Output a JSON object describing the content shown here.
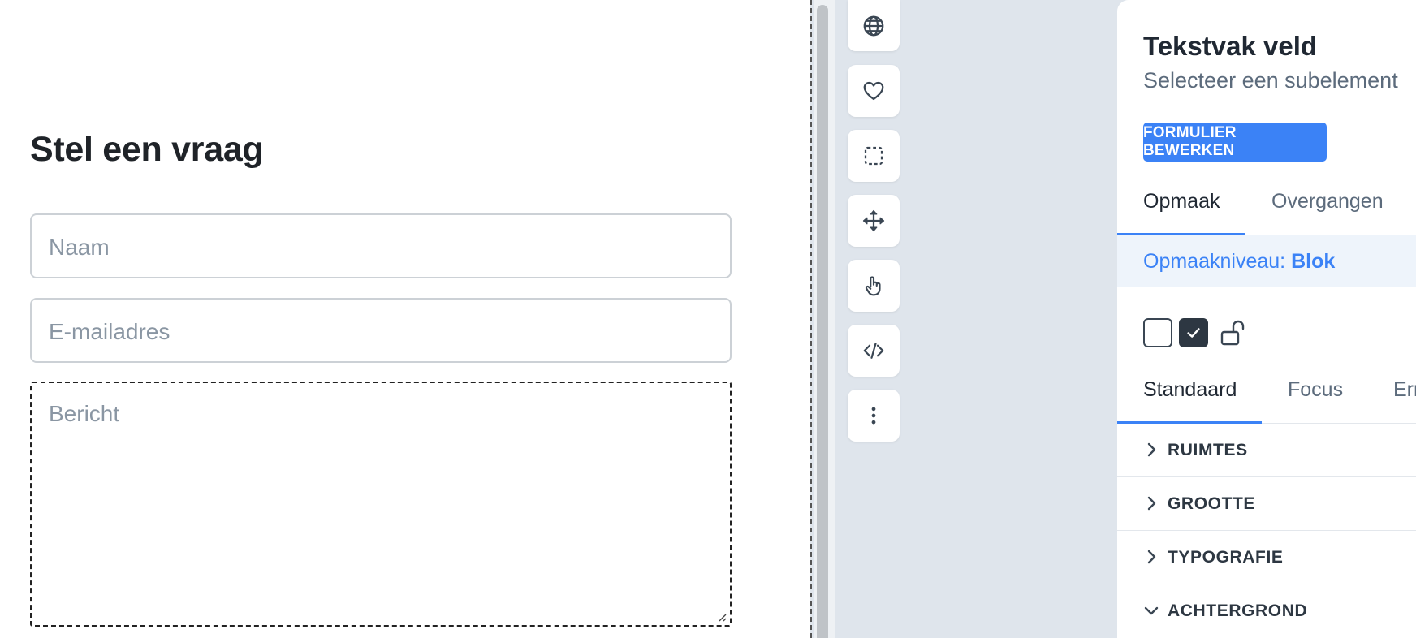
{
  "canvas": {
    "form_title": "Stel een vraag",
    "fields": {
      "name_placeholder": "Naam",
      "email_placeholder": "E-mailadres",
      "message_placeholder": "Bericht"
    }
  },
  "toolbar": {
    "icons": [
      "globe-icon",
      "heart-icon",
      "select-icon",
      "move-icon",
      "pointer-hand-icon",
      "code-icon",
      "more-vertical-icon"
    ]
  },
  "panel": {
    "title": "Tekstvak veld",
    "subtitle": "Selecteer een subelement",
    "edit_form_button": "FORMULIER BEWERKEN",
    "main_tabs": [
      "Opmaak",
      "Overgangen"
    ],
    "active_main_tab": "Opmaak",
    "style_level_label": "Opmaakniveau:",
    "style_level_value": "Blok",
    "state_tabs": [
      "Standaard",
      "Focus",
      "Err"
    ],
    "active_state_tab": "Standaard",
    "accordion": [
      {
        "label": "RUIMTES",
        "expanded": false
      },
      {
        "label": "GROOTTE",
        "expanded": false
      },
      {
        "label": "TYPOGRAFIE",
        "expanded": false
      },
      {
        "label": "ACHTERGROND",
        "expanded": true
      }
    ]
  },
  "colors": {
    "accent": "#3b82f6",
    "text_dark": "#202833",
    "text_muted": "#5c6b7c",
    "workspace_bg": "#dfe5ec"
  }
}
